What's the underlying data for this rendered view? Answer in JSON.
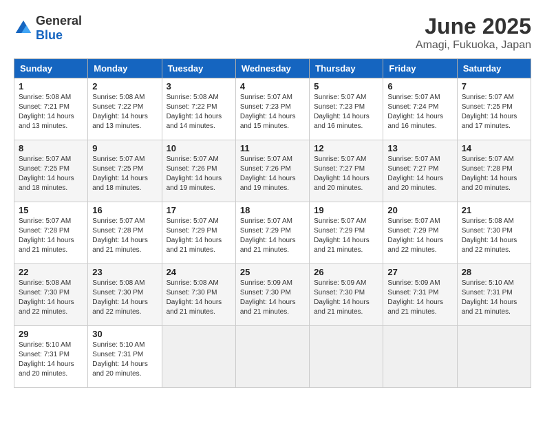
{
  "header": {
    "logo_general": "General",
    "logo_blue": "Blue",
    "month_title": "June 2025",
    "location": "Amagi, Fukuoka, Japan"
  },
  "days_of_week": [
    "Sunday",
    "Monday",
    "Tuesday",
    "Wednesday",
    "Thursday",
    "Friday",
    "Saturday"
  ],
  "weeks": [
    [
      {
        "day": "1",
        "sunrise": "5:08 AM",
        "sunset": "7:21 PM",
        "daylight": "14 hours and 13 minutes."
      },
      {
        "day": "2",
        "sunrise": "5:08 AM",
        "sunset": "7:22 PM",
        "daylight": "14 hours and 13 minutes."
      },
      {
        "day": "3",
        "sunrise": "5:08 AM",
        "sunset": "7:22 PM",
        "daylight": "14 hours and 14 minutes."
      },
      {
        "day": "4",
        "sunrise": "5:07 AM",
        "sunset": "7:23 PM",
        "daylight": "14 hours and 15 minutes."
      },
      {
        "day": "5",
        "sunrise": "5:07 AM",
        "sunset": "7:23 PM",
        "daylight": "14 hours and 16 minutes."
      },
      {
        "day": "6",
        "sunrise": "5:07 AM",
        "sunset": "7:24 PM",
        "daylight": "14 hours and 16 minutes."
      },
      {
        "day": "7",
        "sunrise": "5:07 AM",
        "sunset": "7:25 PM",
        "daylight": "14 hours and 17 minutes."
      }
    ],
    [
      {
        "day": "8",
        "sunrise": "5:07 AM",
        "sunset": "7:25 PM",
        "daylight": "14 hours and 18 minutes."
      },
      {
        "day": "9",
        "sunrise": "5:07 AM",
        "sunset": "7:25 PM",
        "daylight": "14 hours and 18 minutes."
      },
      {
        "day": "10",
        "sunrise": "5:07 AM",
        "sunset": "7:26 PM",
        "daylight": "14 hours and 19 minutes."
      },
      {
        "day": "11",
        "sunrise": "5:07 AM",
        "sunset": "7:26 PM",
        "daylight": "14 hours and 19 minutes."
      },
      {
        "day": "12",
        "sunrise": "5:07 AM",
        "sunset": "7:27 PM",
        "daylight": "14 hours and 20 minutes."
      },
      {
        "day": "13",
        "sunrise": "5:07 AM",
        "sunset": "7:27 PM",
        "daylight": "14 hours and 20 minutes."
      },
      {
        "day": "14",
        "sunrise": "5:07 AM",
        "sunset": "7:28 PM",
        "daylight": "14 hours and 20 minutes."
      }
    ],
    [
      {
        "day": "15",
        "sunrise": "5:07 AM",
        "sunset": "7:28 PM",
        "daylight": "14 hours and 21 minutes."
      },
      {
        "day": "16",
        "sunrise": "5:07 AM",
        "sunset": "7:28 PM",
        "daylight": "14 hours and 21 minutes."
      },
      {
        "day": "17",
        "sunrise": "5:07 AM",
        "sunset": "7:29 PM",
        "daylight": "14 hours and 21 minutes."
      },
      {
        "day": "18",
        "sunrise": "5:07 AM",
        "sunset": "7:29 PM",
        "daylight": "14 hours and 21 minutes."
      },
      {
        "day": "19",
        "sunrise": "5:07 AM",
        "sunset": "7:29 PM",
        "daylight": "14 hours and 21 minutes."
      },
      {
        "day": "20",
        "sunrise": "5:07 AM",
        "sunset": "7:29 PM",
        "daylight": "14 hours and 22 minutes."
      },
      {
        "day": "21",
        "sunrise": "5:08 AM",
        "sunset": "7:30 PM",
        "daylight": "14 hours and 22 minutes."
      }
    ],
    [
      {
        "day": "22",
        "sunrise": "5:08 AM",
        "sunset": "7:30 PM",
        "daylight": "14 hours and 22 minutes."
      },
      {
        "day": "23",
        "sunrise": "5:08 AM",
        "sunset": "7:30 PM",
        "daylight": "14 hours and 22 minutes."
      },
      {
        "day": "24",
        "sunrise": "5:08 AM",
        "sunset": "7:30 PM",
        "daylight": "14 hours and 21 minutes."
      },
      {
        "day": "25",
        "sunrise": "5:09 AM",
        "sunset": "7:30 PM",
        "daylight": "14 hours and 21 minutes."
      },
      {
        "day": "26",
        "sunrise": "5:09 AM",
        "sunset": "7:30 PM",
        "daylight": "14 hours and 21 minutes."
      },
      {
        "day": "27",
        "sunrise": "5:09 AM",
        "sunset": "7:31 PM",
        "daylight": "14 hours and 21 minutes."
      },
      {
        "day": "28",
        "sunrise": "5:10 AM",
        "sunset": "7:31 PM",
        "daylight": "14 hours and 21 minutes."
      }
    ],
    [
      {
        "day": "29",
        "sunrise": "5:10 AM",
        "sunset": "7:31 PM",
        "daylight": "14 hours and 20 minutes."
      },
      {
        "day": "30",
        "sunrise": "5:10 AM",
        "sunset": "7:31 PM",
        "daylight": "14 hours and 20 minutes."
      },
      null,
      null,
      null,
      null,
      null
    ]
  ]
}
